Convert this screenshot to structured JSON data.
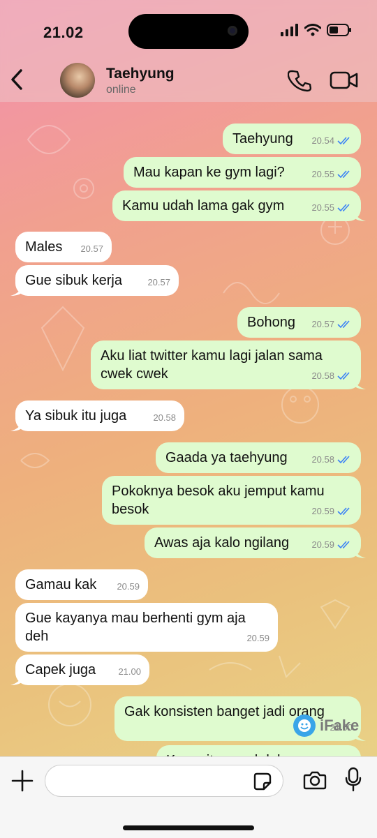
{
  "status_bar": {
    "time": "21.02"
  },
  "contact": {
    "name": "Taehyung",
    "status": "online"
  },
  "messages": [
    {
      "dir": "out",
      "text": "Taehyung",
      "time": "20.54"
    },
    {
      "dir": "out",
      "text": "Mau kapan ke gym lagi?",
      "time": "20.55"
    },
    {
      "dir": "out",
      "text": "Kamu udah lama gak gym",
      "time": "20.55"
    },
    {
      "dir": "in",
      "text": "Males",
      "time": "20.57"
    },
    {
      "dir": "in",
      "text": "Gue sibuk kerja",
      "time": "20.57"
    },
    {
      "dir": "out",
      "text": "Bohong",
      "time": "20.57"
    },
    {
      "dir": "out",
      "text": "Aku liat twitter kamu lagi jalan sama cwek cwek",
      "time": "20.58"
    },
    {
      "dir": "in",
      "text": "Ya sibuk itu juga",
      "time": "20.58"
    },
    {
      "dir": "out",
      "text": "Gaada ya taehyung",
      "time": "20.58"
    },
    {
      "dir": "out",
      "text": "Pokoknya besok aku jemput kamu besok",
      "time": "20.59"
    },
    {
      "dir": "out",
      "text": "Awas aja kalo ngilang",
      "time": "20.59"
    },
    {
      "dir": "in",
      "text": "Gamau kak",
      "time": "20.59"
    },
    {
      "dir": "in",
      "text": "Gue kayanya mau berhenti gym aja deh",
      "time": "20.59"
    },
    {
      "dir": "in",
      "text": "Capek juga",
      "time": "21.00"
    },
    {
      "dir": "out",
      "text": "Gak konsisten banget jadi orang",
      "time": "21.00"
    },
    {
      "dir": "out",
      "text": "Kamu itu susah lah",
      "time": ""
    }
  ],
  "input": {
    "placeholder": ""
  },
  "watermark": {
    "text": "iFake"
  },
  "colors": {
    "outgoing_bubble": "#dffbcf",
    "incoming_bubble": "#ffffff",
    "read_tick": "#3b82f6"
  },
  "icons": [
    "back-icon",
    "phone-icon",
    "video-icon",
    "plus-icon",
    "sticker-icon",
    "camera-icon",
    "mic-icon",
    "double-check-icon"
  ]
}
